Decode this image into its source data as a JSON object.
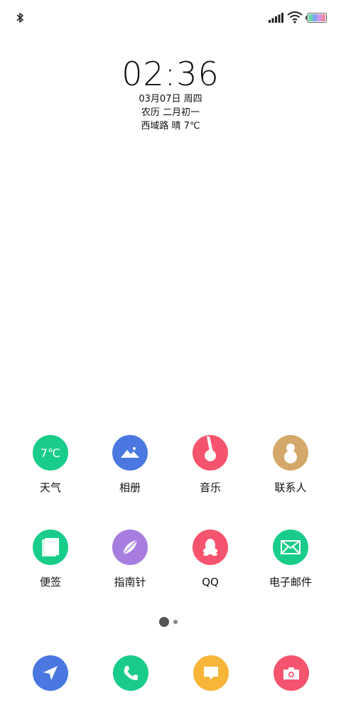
{
  "status_bar": {
    "icons": [
      "bluetooth-icon",
      "signal-icon",
      "wifi-icon",
      "battery-icon"
    ]
  },
  "lockclock": {
    "time": "02:36",
    "date": "03月07日 周四",
    "lunar": "农历 二月初一",
    "weather": "西域路 晴 7℃"
  },
  "apps": [
    {
      "label": "天气",
      "icon": "weather-icon",
      "icon_text": "7℃",
      "color": "#19CC8A"
    },
    {
      "label": "相册",
      "icon": "gallery-icon",
      "color": "#4A78E0"
    },
    {
      "label": "音乐",
      "icon": "music-icon",
      "color": "#F5546E"
    },
    {
      "label": "联系人",
      "icon": "contacts-icon",
      "color": "#D4A86A"
    },
    {
      "label": "便签",
      "icon": "notes-icon",
      "color": "#19CC8A"
    },
    {
      "label": "指南针",
      "icon": "compass-icon",
      "color": "#A77EE0"
    },
    {
      "label": "QQ",
      "icon": "qq-icon",
      "color": "#F5546E"
    },
    {
      "label": "电子邮件",
      "icon": "email-icon",
      "color": "#19CC8A"
    }
  ],
  "dock": [
    {
      "icon": "navigation-icon",
      "color": "#4A78E0"
    },
    {
      "icon": "phone-icon",
      "color": "#19CC8A"
    },
    {
      "icon": "messages-icon",
      "color": "#F7B53A"
    },
    {
      "icon": "camera-icon",
      "color": "#F5546E"
    }
  ],
  "pages": {
    "count": 2,
    "current": 1
  }
}
